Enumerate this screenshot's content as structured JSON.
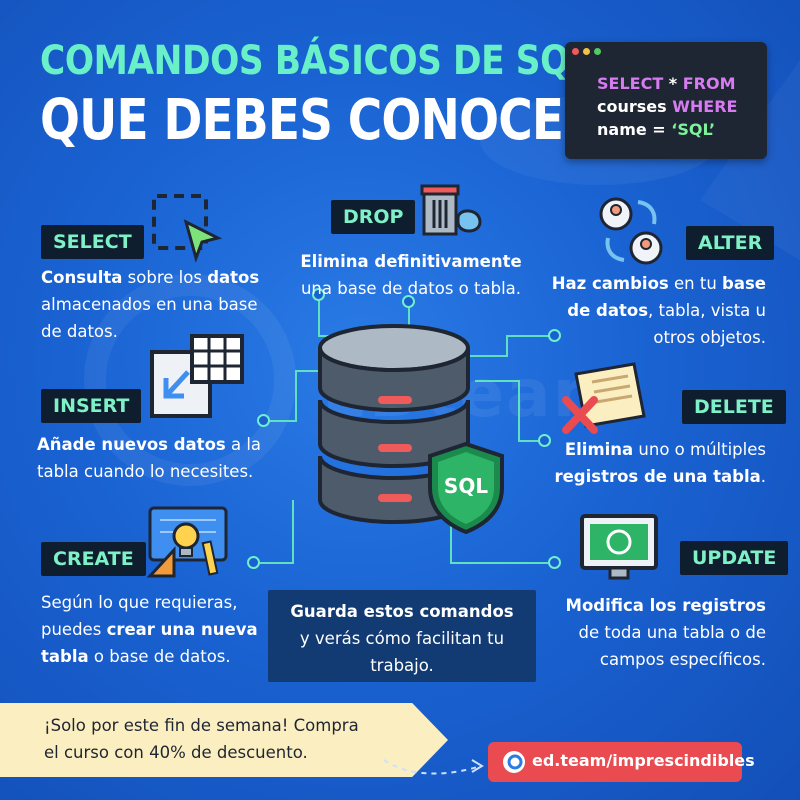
{
  "header": {
    "title_line1": "COMANDOS BÁSICOS DE SQL",
    "title_line2": "QUE DEBES CONOCER"
  },
  "code": {
    "line1_kw1": "SELECT",
    "line1_sym": " * ",
    "line1_kw2": "FROM",
    "line2_word": "courses ",
    "line2_kw": "WHERE",
    "line3_word": "name = ",
    "line3_str": "‘SQL’"
  },
  "commands": {
    "select": {
      "label": "SELECT",
      "d1": "Consulta",
      "d2": " sobre los ",
      "d3": "datos",
      "d4": "almacenados en una base",
      "d5": "de datos."
    },
    "drop": {
      "label": "DROP",
      "d1": "Elimina definitivamente",
      "d2": "una base de datos o tabla."
    },
    "alter": {
      "label": "ALTER",
      "d1": "Haz cambios",
      "d2": " en tu ",
      "d3": "base",
      "d4": "de datos",
      "d5": ", tabla, vista u",
      "d6": "otros objetos."
    },
    "insert": {
      "label": "INSERT",
      "d1": "Añade nuevos datos",
      "d2": " a la",
      "d3": "tabla cuando lo necesites."
    },
    "delete": {
      "label": "DELETE",
      "d1": "Elimina",
      "d2": " uno o múltiples",
      "d3": "registros de una tabla",
      "d4": "."
    },
    "create": {
      "label": "CREATE",
      "d1": "Según lo que requieras,",
      "d2": "puedes ",
      "d3": "crear una nueva",
      "d4": "tabla",
      "d5": " o base de datos."
    },
    "update": {
      "label": "UPDATE",
      "d1": "Modifica los registros",
      "d2": "de toda una tabla o de",
      "d3": "campos específicos."
    }
  },
  "note": {
    "line1": "Guarda estos comandos",
    "line2": "y verás cómo facilitan tu",
    "line3": "trabajo."
  },
  "badge": {
    "text": "SQL"
  },
  "watermark": {
    "text": "EDteam"
  },
  "promo": {
    "line1": "¡Solo por este fin de semana! Compra",
    "line2": "el curso con 40% de descuento."
  },
  "cta": {
    "text": "ed.team/imprescindibles"
  },
  "colors": {
    "background": "#1a63d3",
    "title_accent": "#69f0c8",
    "label_bg": "#0f1e2e",
    "label_text": "#7ef2c6",
    "cta_bg": "#e94b51",
    "promo_bg": "#fbeec0"
  }
}
